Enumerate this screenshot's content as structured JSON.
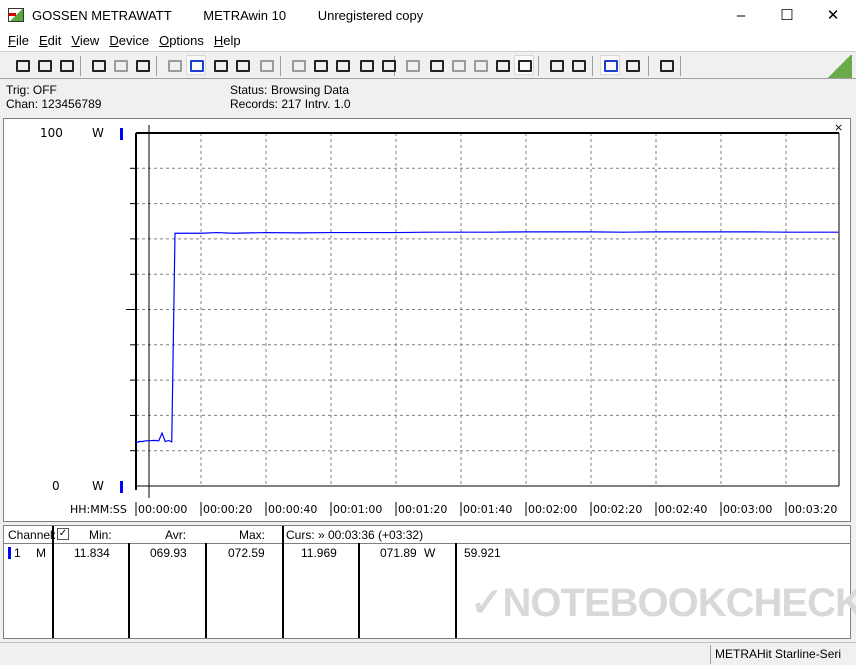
{
  "window": {
    "brand": "GOSSEN METRAWATT",
    "app": "METRAwin 10",
    "license": "Unregistered copy",
    "controls": [
      "minimize",
      "maximize",
      "close"
    ]
  },
  "menu": [
    "File",
    "Edit",
    "View",
    "Device",
    "Options",
    "Help"
  ],
  "toolbar": {
    "icons": [
      "save-icon",
      "save-as-icon",
      "open-folder-icon",
      "read-memory-icon",
      "read-memory-disabled-icon",
      "memory-icon",
      "display-icon",
      "chart-icon",
      "crosshair-icon",
      "table-icon",
      "bar-chart-icon",
      "transfer-icon",
      "export-icon",
      "digital-icon",
      "monitor-icon",
      "function-icon",
      "meter-icon",
      "cursor-icon",
      "wave-icon",
      "wave2-icon",
      "clock-icon",
      "stopwatch-icon",
      "print-icon",
      "printer-icon",
      "zoom-wave-icon",
      "zoom-search-icon",
      "comment-icon"
    ],
    "accent": "#6aaa4a"
  },
  "info": {
    "trig": "Trig: OFF",
    "chan": "Chan:  123456789",
    "status_label": "Status:",
    "status_value": "Browsing Data",
    "records": "Records: 217   Intrv. 1.0"
  },
  "chart_data": {
    "type": "line",
    "y_top_label": "100",
    "y_bottom_label": "0",
    "y_unit": "W",
    "xlabel": "HH:MM:SS",
    "ylim": [
      0,
      100
    ],
    "xlim_seconds": [
      0,
      216
    ],
    "x_ticks": [
      "00:00:00",
      "00:00:20",
      "00:00:40",
      "00:01:00",
      "00:01:20",
      "00:01:40",
      "00:02:00",
      "00:02:20",
      "00:02:40",
      "00:03:00",
      "00:03:20"
    ],
    "grid": true,
    "series_color": "#0000ff",
    "cursor_time": "00:00:04",
    "series": [
      {
        "x": [
          0,
          1,
          2,
          3,
          4,
          5,
          6,
          7,
          8,
          9,
          10,
          11,
          12,
          20,
          25,
          30,
          40,
          50,
          60,
          70,
          80,
          90,
          100,
          110,
          120,
          130,
          140,
          150,
          160,
          170,
          180,
          190,
          200,
          210,
          216
        ],
        "y": [
          12.2,
          12.6,
          12.6,
          12.8,
          12.8,
          12.9,
          12.9,
          12.8,
          15.0,
          12.6,
          12.9,
          12.5,
          71.6,
          71.6,
          71.8,
          71.6,
          71.8,
          71.7,
          71.8,
          71.8,
          71.8,
          71.9,
          71.9,
          71.9,
          72.0,
          72.0,
          72.0,
          71.9,
          72.0,
          72.0,
          72.0,
          72.0,
          71.9,
          71.9,
          71.9
        ]
      }
    ]
  },
  "table": {
    "headers": {
      "channel": "Channel:",
      "min": "Min:",
      "avr": "Avr:",
      "max": "Max:",
      "curs": "Curs: » 00:03:36 (+03:32)"
    },
    "rows": [
      {
        "ch": "1",
        "mode": "M",
        "min": "11.834",
        "avr": "069.93",
        "max": "072.59",
        "curs_a": "11.969",
        "curs_b": "071.89",
        "unit": "W",
        "curs_c": "59.921"
      }
    ]
  },
  "statusbar": {
    "device": "METRAHit Starline-Seri"
  },
  "watermark": "NOTEBOOKCHECK"
}
